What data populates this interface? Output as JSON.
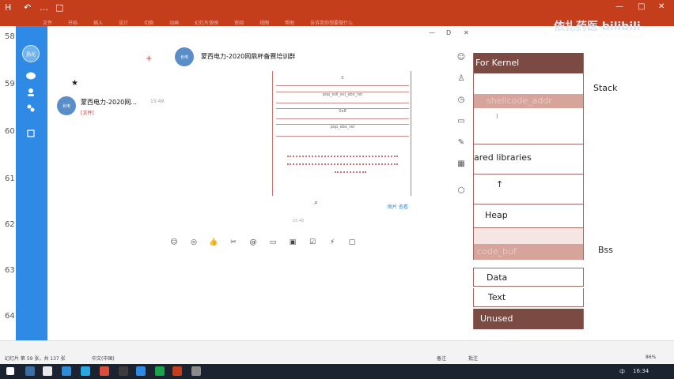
{
  "ribbon": {
    "quick_access": [
      "H",
      "↶",
      "…",
      "□"
    ],
    "tabs": [
      "文件",
      "开始",
      "插入",
      "设计",
      "切换",
      "动画",
      "幻灯片放映",
      "审阅",
      "视图",
      "帮助",
      "告诉我你想要做什么"
    ],
    "window_controls": [
      "—",
      "□",
      "✕"
    ]
  },
  "watermark": {
    "text": "依扎药医 bilibili"
  },
  "slide_numbers": [
    "58",
    "59",
    "60",
    "61",
    "62",
    "63",
    "64"
  ],
  "sidebar": {
    "avatar_label": "扬光",
    "icons": [
      "message-icon",
      "contacts-icon",
      "space-icon",
      "star-icon"
    ]
  },
  "chat_list": {
    "add_label": "+",
    "conversation": {
      "avatar_text": "长电",
      "name": "蒙西电力-2020网...",
      "time": "15:49",
      "preview": "[文件]"
    }
  },
  "chat_main": {
    "header_avatar": "长电",
    "header_name": "蒙西电力-2020网鼎杯备赛培训群",
    "window_controls": [
      "—",
      "D",
      "✕"
    ],
    "code_rows": [
      "0",
      "pop_edi_esi_ebx_ret",
      "0x8",
      "pop_ebx_ret"
    ],
    "image_caption": "图片 查看",
    "time_separator": "15:40",
    "tools": [
      "emoji-icon",
      "gif-icon",
      "like-icon",
      "scissors-icon",
      "at-icon",
      "folder-icon",
      "image-icon",
      "doc-icon",
      "shake-icon",
      "screen-icon"
    ],
    "side_tools": [
      "smile-icon",
      "person-icon",
      "history-icon",
      "folder-icon",
      "comment-icon",
      "calendar-icon",
      "cube-icon"
    ]
  },
  "memory_diagram": {
    "rows": [
      {
        "label": "For Kernel",
        "dark": true
      },
      {
        "label": "",
        "dark": false
      },
      {
        "label": "shellcode_addr",
        "dark": true
      },
      {
        "label": "",
        "dark": false
      },
      {
        "label": "ared libraries",
        "dark": false
      },
      {
        "label": "",
        "dark": false
      },
      {
        "label": "Heap",
        "dark": false
      },
      {
        "label": "",
        "dark": false
      },
      {
        "label": "code_buf",
        "dark": true
      },
      {
        "label": "Data",
        "dark": false
      },
      {
        "label": "Text",
        "dark": false
      },
      {
        "label": "Unused",
        "dark": true
      }
    ],
    "labels": {
      "stack": "Stack",
      "bss": "Bss"
    }
  },
  "statusbar": {
    "slide_info": "幻灯片 第 59 张，共 137 张",
    "language": "中文(中国)",
    "notes": "备注",
    "comments": "批注",
    "zoom": "86%"
  },
  "taskbar": {
    "time": "16:34",
    "ime": "中"
  }
}
